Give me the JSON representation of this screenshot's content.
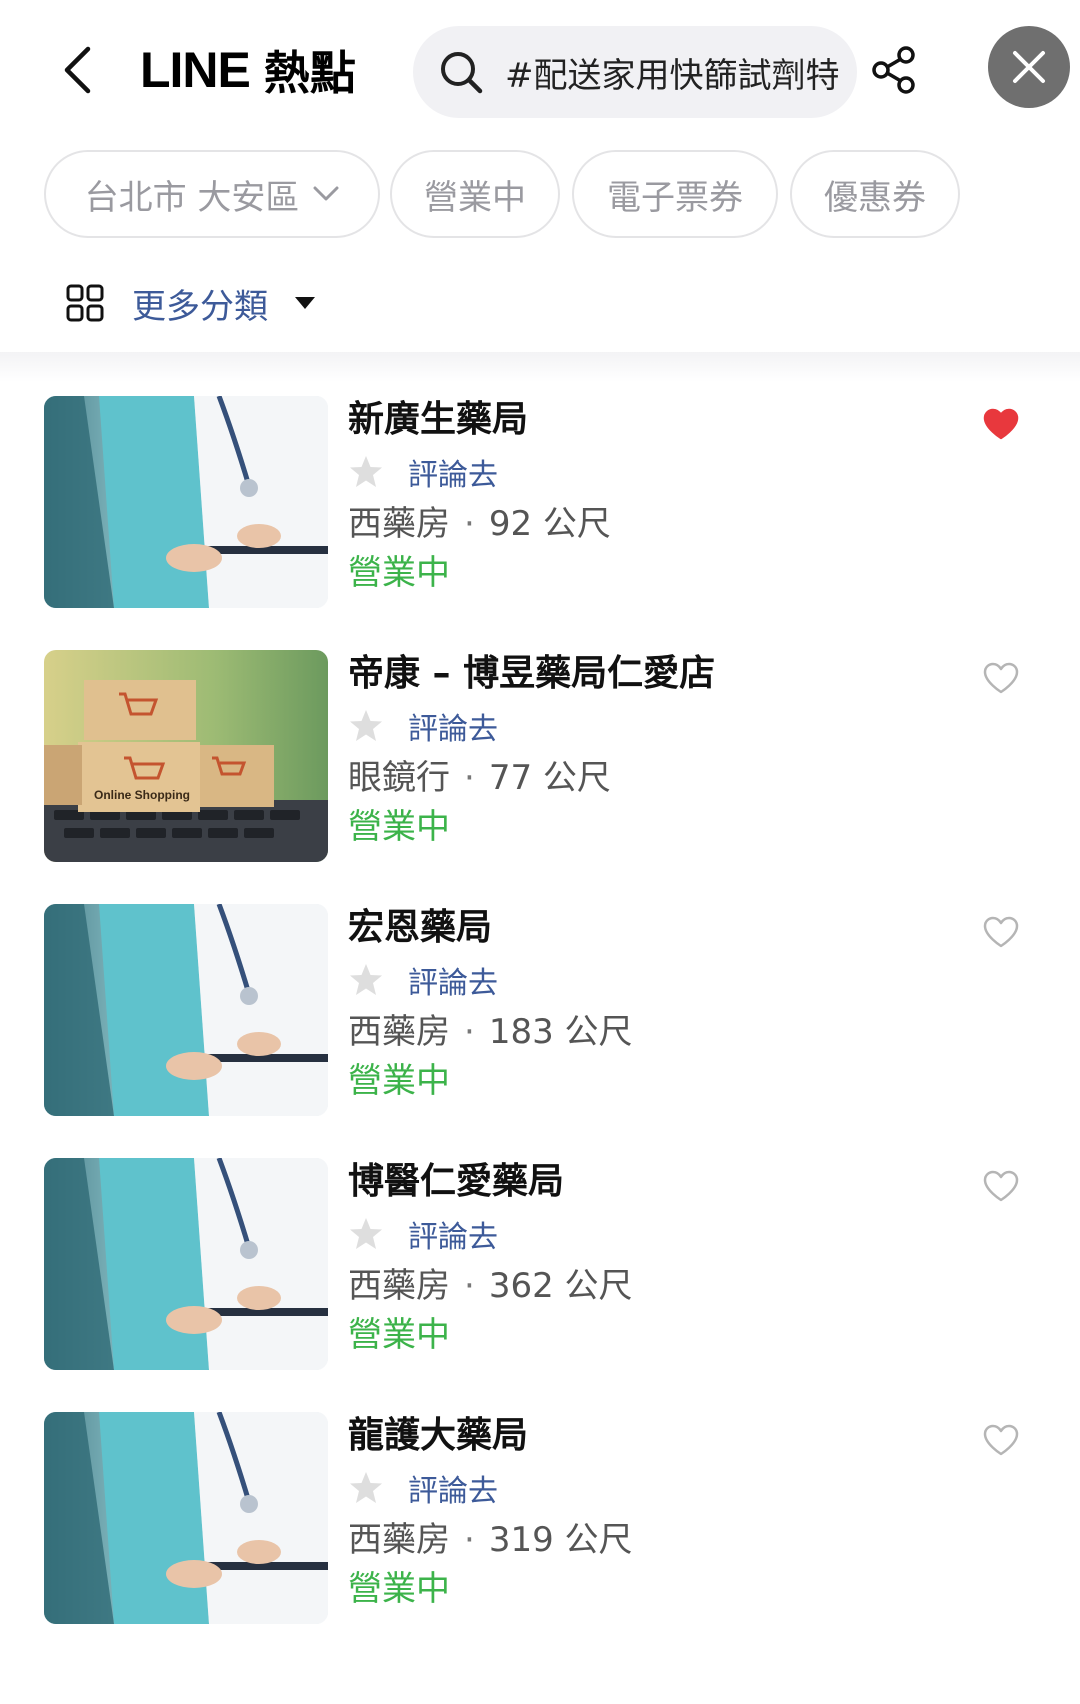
{
  "header": {
    "brand_line": "LINE",
    "brand_hot": "熱點",
    "search_text": "#配送家用快篩試劑特",
    "back_icon": "chevron-left-icon",
    "share_icon": "share-icon",
    "close_icon": "close-icon"
  },
  "filters": {
    "district": "台北市 大安區",
    "open_now": "營業中",
    "e_ticket": "電子票券",
    "coupon": "優惠券"
  },
  "category": {
    "label": "更多分類"
  },
  "colors": {
    "accent_blue": "#3d5a99",
    "open_green": "#3cb34a",
    "favorite_red": "#e8383d",
    "close_button_bg": "#6f6f6f"
  },
  "stores": [
    {
      "name": "新廣生藥局",
      "review": "評論去",
      "category": "西藥房",
      "distance": "92 公尺",
      "status": "營業中",
      "favorited": true,
      "image": "doctor-photo"
    },
    {
      "name": "帝康 – 博昱藥局仁愛店",
      "review": "評論去",
      "category": "眼鏡行",
      "distance": "77 公尺",
      "status": "營業中",
      "favorited": false,
      "image": "online-shopping-photo"
    },
    {
      "name": "宏恩藥局",
      "review": "評論去",
      "category": "西藥房",
      "distance": "183 公尺",
      "status": "營業中",
      "favorited": false,
      "image": "doctor-photo"
    },
    {
      "name": "博醫仁愛藥局",
      "review": "評論去",
      "category": "西藥房",
      "distance": "362 公尺",
      "status": "營業中",
      "favorited": false,
      "image": "doctor-photo"
    },
    {
      "name": "龍護大藥局",
      "review": "評論去",
      "category": "西藥房",
      "distance": "319 公尺",
      "status": "營業中",
      "favorited": false,
      "image": "doctor-photo"
    }
  ],
  "thumb_text": {
    "online_shopping": "Online Shopping"
  }
}
